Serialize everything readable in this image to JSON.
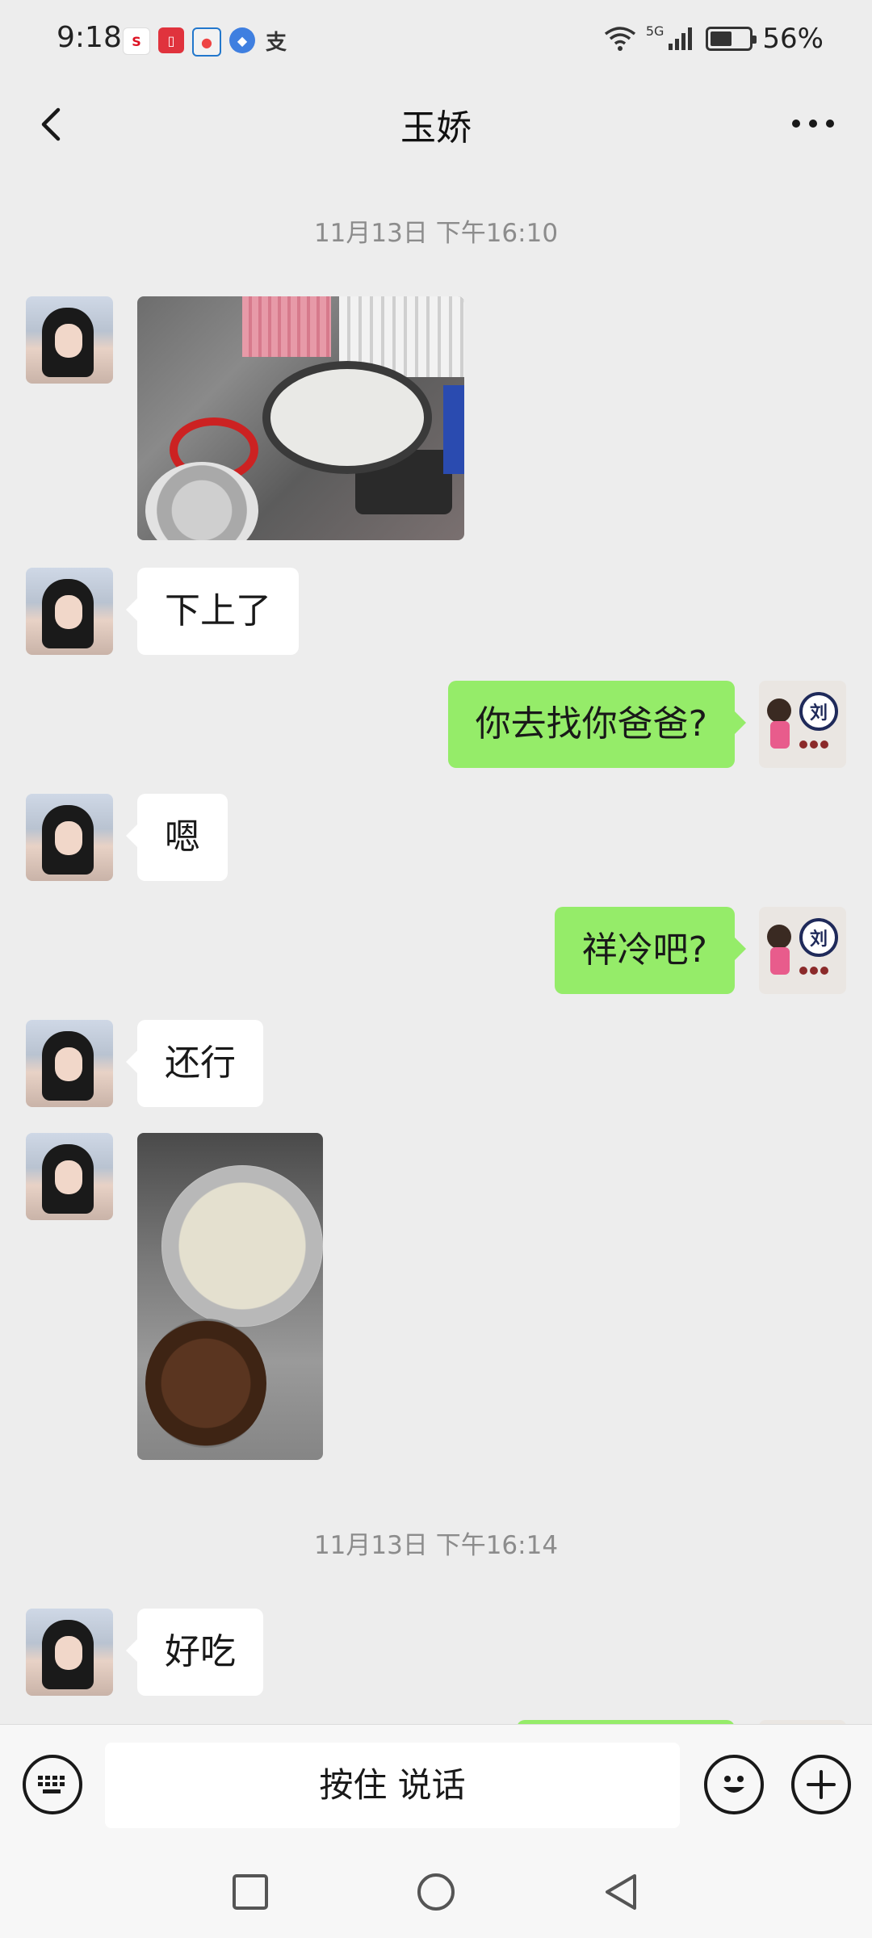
{
  "status_bar": {
    "time": "9:18",
    "network": "5G",
    "battery_percent": "56%",
    "battery_level": 0.56,
    "app_icons": [
      "sina-icon",
      "book-icon",
      "browser-icon",
      "compass-icon",
      "alipay-icon"
    ]
  },
  "header": {
    "title": "玉娇",
    "back_icon": "chevron-left-icon",
    "more_icon": "more-dots-icon"
  },
  "chat": {
    "timestamps": [
      "11月13日 下午16:10",
      "11月13日 下午16:14"
    ],
    "messages": [
      {
        "side": "left",
        "type": "image",
        "description_icon": "photo-dumplings-cooking"
      },
      {
        "side": "left",
        "type": "text",
        "text": "下上了"
      },
      {
        "side": "right",
        "type": "text",
        "text": "你去找你爸爸?"
      },
      {
        "side": "left",
        "type": "text",
        "text": "嗯"
      },
      {
        "side": "right",
        "type": "text",
        "text": "祥冷吧?"
      },
      {
        "side": "left",
        "type": "text",
        "text": "还行"
      },
      {
        "side": "left",
        "type": "image",
        "description_icon": "photo-dumplings-bowl"
      },
      {
        "side": "left",
        "type": "text",
        "text": "好吃"
      }
    ]
  },
  "input_bar": {
    "voice_label": "按住 说话",
    "keyboard_icon": "keyboard-icon",
    "emoji_icon": "emoji-icon",
    "plus_icon": "plus-icon"
  },
  "system_nav": {
    "icons": [
      "recent-apps-icon",
      "home-icon",
      "back-icon"
    ]
  },
  "colors": {
    "background": "#ededed",
    "bubble_sent": "#95ec69",
    "bubble_received": "#ffffff"
  }
}
